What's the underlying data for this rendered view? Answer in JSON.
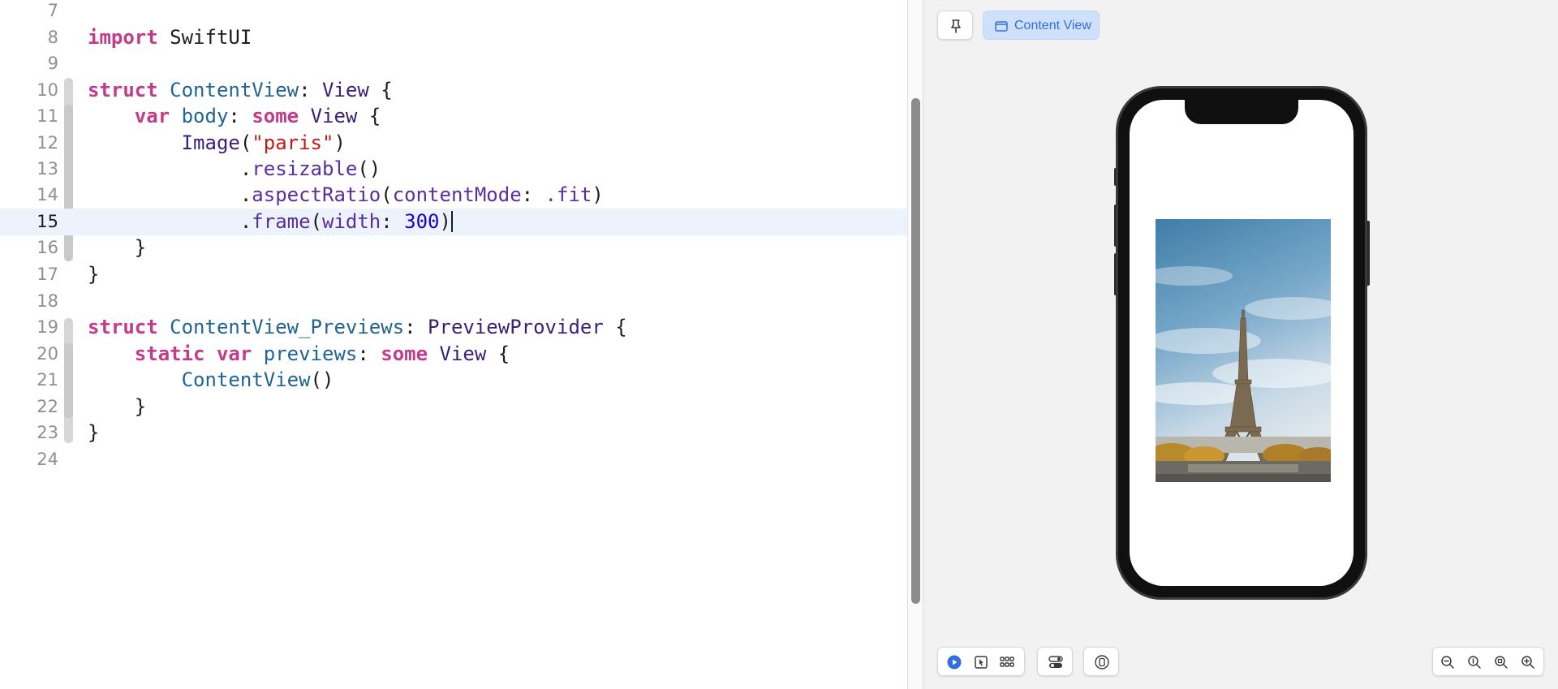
{
  "editor": {
    "current_line": "15",
    "lines": [
      {
        "n": "7"
      },
      {
        "n": "8"
      },
      {
        "n": "9"
      },
      {
        "n": "10"
      },
      {
        "n": "11"
      },
      {
        "n": "12"
      },
      {
        "n": "13"
      },
      {
        "n": "14"
      },
      {
        "n": "15"
      },
      {
        "n": "16"
      },
      {
        "n": "17"
      },
      {
        "n": "18"
      },
      {
        "n": "19"
      },
      {
        "n": "20"
      },
      {
        "n": "21"
      },
      {
        "n": "22"
      },
      {
        "n": "23"
      },
      {
        "n": "24"
      }
    ],
    "tokens": {
      "import_kw": "import",
      "swiftui": "SwiftUI",
      "struct_kw": "struct",
      "contentview": "ContentView",
      "colon": ":",
      "view": "View",
      "open_brace": "{",
      "close_brace": "}",
      "var_kw": "var",
      "body": "body",
      "some_kw": "some",
      "image": "Image",
      "open_paren": "(",
      "close_paren": ")",
      "paris_str": "\"paris\"",
      "dot": ".",
      "resizable": "resizable",
      "empty_parens": "()",
      "aspect_ratio": "aspectRatio",
      "content_mode": "contentMode",
      "fit": ".fit",
      "frame": "frame",
      "width": "width",
      "width_value": "300",
      "contentview_previews": "ContentView_Previews",
      "preview_provider": "PreviewProvider",
      "static_kw": "static",
      "previews": "previews"
    }
  },
  "preview": {
    "pin_icon": "pin-icon",
    "chip_label": "Content View",
    "chip_icon": "preview-window-icon",
    "photo_subject": "Eiffel Tower",
    "toolbar": {
      "live_icon": "play-circle-icon",
      "select_icon": "selectable-cursor-icon",
      "variants_icon": "grid-dots-icon",
      "device_settings_icon": "toggles-icon",
      "device_icon": "device-circle-icon",
      "zoom_icons": [
        "zoom-out-icon",
        "zoom-100-icon",
        "zoom-fit-icon",
        "zoom-in-icon"
      ]
    }
  },
  "colors": {
    "keyword": "#c33b8a",
    "declaration": "#1f6493",
    "type": "#3a1f7a",
    "string": "#c41a16",
    "number": "#1c00cf",
    "accent": "#2f6fe0",
    "current_line_bg": "#edf3fd"
  }
}
